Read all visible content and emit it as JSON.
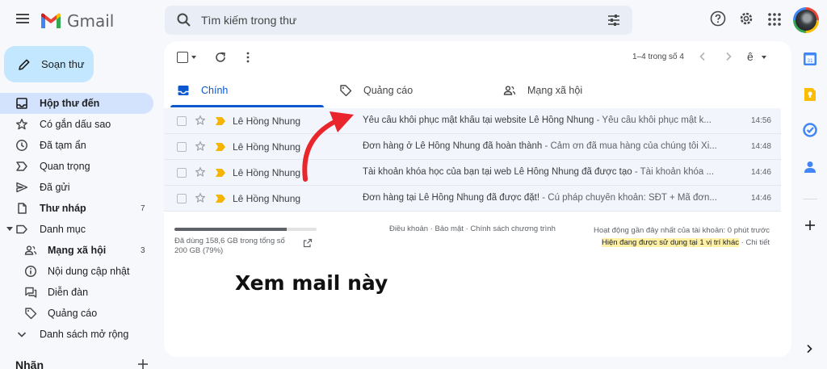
{
  "app": {
    "name": "Gmail"
  },
  "search": {
    "placeholder": "Tìm kiếm trong thư"
  },
  "compose": {
    "label": "Soạn thư"
  },
  "sidebar": {
    "items": [
      {
        "label": "Hộp thư đến",
        "icon": "inbox-icon",
        "active": true,
        "count": ""
      },
      {
        "label": "Có gắn dấu sao",
        "icon": "star-icon",
        "count": ""
      },
      {
        "label": "Đã tạm ẩn",
        "icon": "clock-icon",
        "count": ""
      },
      {
        "label": "Quan trọng",
        "icon": "label-important-icon",
        "count": ""
      },
      {
        "label": "Đã gửi",
        "icon": "send-icon",
        "count": ""
      },
      {
        "label": "Thư nháp",
        "icon": "draft-icon",
        "count": "7"
      },
      {
        "label": "Danh mục",
        "icon": "category-label-icon",
        "count": ""
      },
      {
        "label": "Mạng xã hội",
        "icon": "people-icon",
        "count": "3"
      },
      {
        "label": "Nội dung cập nhật",
        "icon": "info-icon",
        "count": ""
      },
      {
        "label": "Diễn đàn",
        "icon": "forum-icon",
        "count": ""
      },
      {
        "label": "Quảng cáo",
        "icon": "tag-icon",
        "count": ""
      },
      {
        "label": "Danh sách mở rộng",
        "icon": "expand-more-icon",
        "count": ""
      }
    ],
    "labels_heading": "Nhãn"
  },
  "toolbar": {
    "pager": "1–4 trong số 4",
    "input_tool": "ê"
  },
  "tabs": [
    {
      "label": "Chính",
      "icon": "inbox-icon",
      "active": true
    },
    {
      "label": "Quảng cáo",
      "icon": "tag-icon"
    },
    {
      "label": "Mạng xã hội",
      "icon": "people-icon"
    }
  ],
  "emails": [
    {
      "sender": "Lê Hồng Nhung",
      "subject": "Yêu cầu khôi phục mật khẩu tại website Lê Hồng Nhung",
      "preview": " - Yêu cầu khôi phục mật k...",
      "time": "14:56"
    },
    {
      "sender": "Lê Hồng Nhung",
      "subject": "Đơn hàng ở Lê Hồng Nhung đã hoàn thành",
      "preview": " - Cảm ơn đã mua hàng của chúng tôi Xi...",
      "time": "14:48"
    },
    {
      "sender": "Lê Hồng Nhung",
      "subject": "Tài khoản khóa học của bạn tại web Lê Hồng Nhung đã được tạo",
      "preview": " - Tài khoản khóa ...",
      "time": "14:46"
    },
    {
      "sender": "Lê Hồng Nhung",
      "subject": "Đơn hàng tại Lê Hồng Nhung đã được đặt!",
      "preview": " - Cú pháp chuyển khoản: SĐT + Mã đơn...",
      "time": "14:46"
    }
  ],
  "footer": {
    "storage_text": "Đã dùng 158,6 GB trong tổng số 200 GB (79%)",
    "storage_fraction": 0.79,
    "links": "Điều khoản · Bảo mật · Chính sách chương trình",
    "activity_line": "Hoạt động gần đây nhất của tài khoản: 0 phút trước",
    "activity_highlight": "Hiện đang được sử dụng tại 1 vị trí khác",
    "activity_details": " · Chi tiết"
  },
  "overlay": {
    "text": "Xem mail này"
  },
  "colors": {
    "accent": "#0b57d0",
    "compose": "#c2e7ff",
    "active_nav": "#d3e3fd",
    "arrow": "#e8262c",
    "highlight": "#fef0a5"
  }
}
